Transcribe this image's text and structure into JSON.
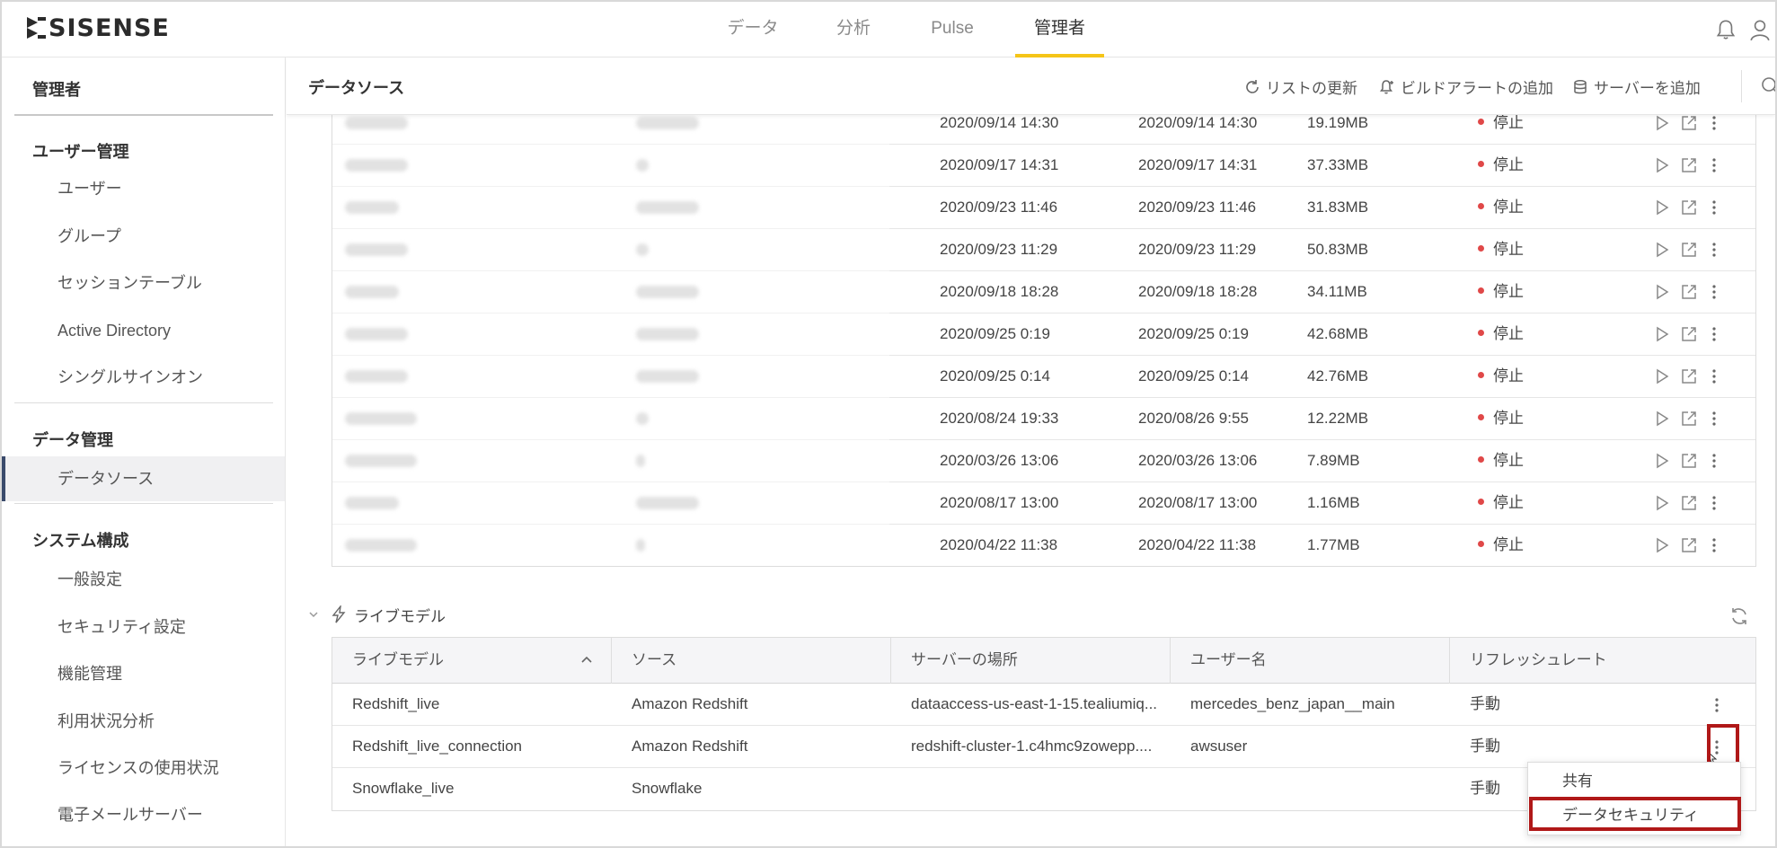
{
  "app": {
    "logo_text": "SISENSE",
    "nav": [
      "データ",
      "分析",
      "Pulse",
      "管理者"
    ],
    "active_nav": "管理者"
  },
  "sidebar": {
    "title": "管理者",
    "groups": [
      {
        "label": "ユーザー管理",
        "items": [
          "ユーザー",
          "グループ",
          "セッションテーブル",
          "Active Directory",
          "シングルサインオン"
        ]
      },
      {
        "label": "データ管理",
        "items": [
          "データソース"
        ]
      },
      {
        "label": "システム構成",
        "items": [
          "一般設定",
          "セキュリティ設定",
          "機能管理",
          "利用状況分析",
          "ライセンスの使用状況",
          "電子メールサーバー"
        ]
      }
    ],
    "active_item": "データソース"
  },
  "header": {
    "title": "データソース",
    "actions": {
      "refresh": "リストの更新",
      "build_alert": "ビルドアラートの追加",
      "add_server": "サーバーを追加"
    }
  },
  "elasticubes": {
    "rows": [
      {
        "last_build": "2020/09/14 14:30",
        "last_success": "2020/09/14 14:30",
        "size": "19.19MB",
        "status": "停止"
      },
      {
        "last_build": "2020/09/17 14:31",
        "last_success": "2020/09/17 14:31",
        "size": "37.33MB",
        "status": "停止"
      },
      {
        "last_build": "2020/09/23 11:46",
        "last_success": "2020/09/23 11:46",
        "size": "31.83MB",
        "status": "停止"
      },
      {
        "last_build": "2020/09/23 11:29",
        "last_success": "2020/09/23 11:29",
        "size": "50.83MB",
        "status": "停止"
      },
      {
        "last_build": "2020/09/18 18:28",
        "last_success": "2020/09/18 18:28",
        "size": "34.11MB",
        "status": "停止"
      },
      {
        "last_build": "2020/09/25 0:19",
        "last_success": "2020/09/25 0:19",
        "size": "42.68MB",
        "status": "停止"
      },
      {
        "last_build": "2020/09/25 0:14",
        "last_success": "2020/09/25 0:14",
        "size": "42.76MB",
        "status": "停止"
      },
      {
        "last_build": "2020/08/24 19:33",
        "last_success": "2020/08/26 9:55",
        "size": "12.22MB",
        "status": "停止"
      },
      {
        "last_build": "2020/03/26 13:06",
        "last_success": "2020/03/26 13:06",
        "size": "7.89MB",
        "status": "停止"
      },
      {
        "last_build": "2020/08/17 13:00",
        "last_success": "2020/08/17 13:00",
        "size": "1.16MB",
        "status": "停止"
      },
      {
        "last_build": "2020/04/22 11:38",
        "last_success": "2020/04/22 11:38",
        "size": "1.77MB",
        "status": "停止"
      }
    ]
  },
  "live_models": {
    "section_title": "ライブモデル",
    "columns": [
      "ライブモデル",
      "ソース",
      "サーバーの場所",
      "ユーザー名",
      "リフレッシュレート"
    ],
    "rows": [
      {
        "name": "Redshift_live",
        "source": "Amazon Redshift",
        "server": "dataaccess-us-east-1-15.tealiumiq...",
        "user": "mercedes_benz_japan__main",
        "refresh": "手動"
      },
      {
        "name": "Redshift_live_connection",
        "source": "Amazon Redshift",
        "server": "redshift-cluster-1.c4hmc9zowepp....",
        "user": "awsuser",
        "refresh": "手動"
      },
      {
        "name": "Snowflake_live",
        "source": "Snowflake",
        "server": "",
        "user": "",
        "refresh": "手動"
      }
    ]
  },
  "context_menu": {
    "items": [
      "共有",
      "データセキュリティ"
    ]
  },
  "colors": {
    "accent_tab": "#f5c518",
    "status_stopped": "#e04848",
    "highlight": "#b01818",
    "sidebar_active_bar": "#3a4a6b"
  }
}
